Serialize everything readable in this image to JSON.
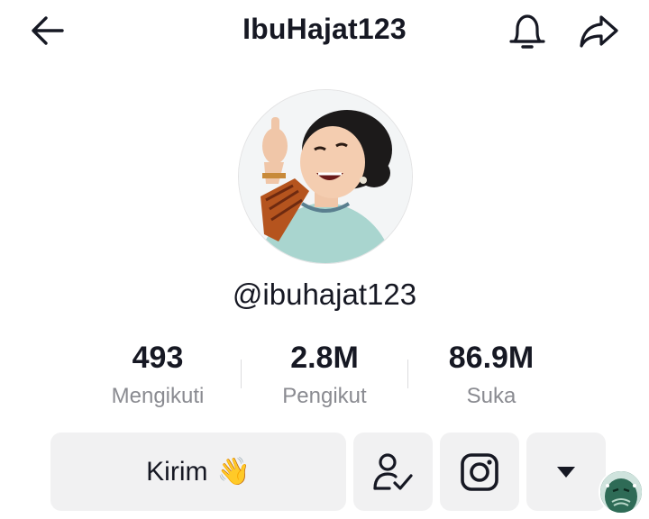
{
  "header": {
    "title": "IbuHajat123",
    "back_icon": "arrow-left-icon",
    "bell_icon": "bell-icon",
    "share_icon": "share-arrow-icon"
  },
  "profile": {
    "handle": "@ibuhajat123"
  },
  "stats": [
    {
      "value": "493",
      "label": "Mengikuti"
    },
    {
      "value": "2.8M",
      "label": "Pengikut"
    },
    {
      "value": "86.9M",
      "label": "Suka"
    }
  ],
  "actions": {
    "kirim_label": "Kirim",
    "kirim_emoji": "👋",
    "follow_icon": "user-check-icon",
    "instagram_icon": "instagram-icon",
    "more_icon": "caret-down-icon"
  },
  "colors": {
    "text": "#161823",
    "muted": "#8a8b91",
    "button_bg": "#f1f1f2"
  }
}
